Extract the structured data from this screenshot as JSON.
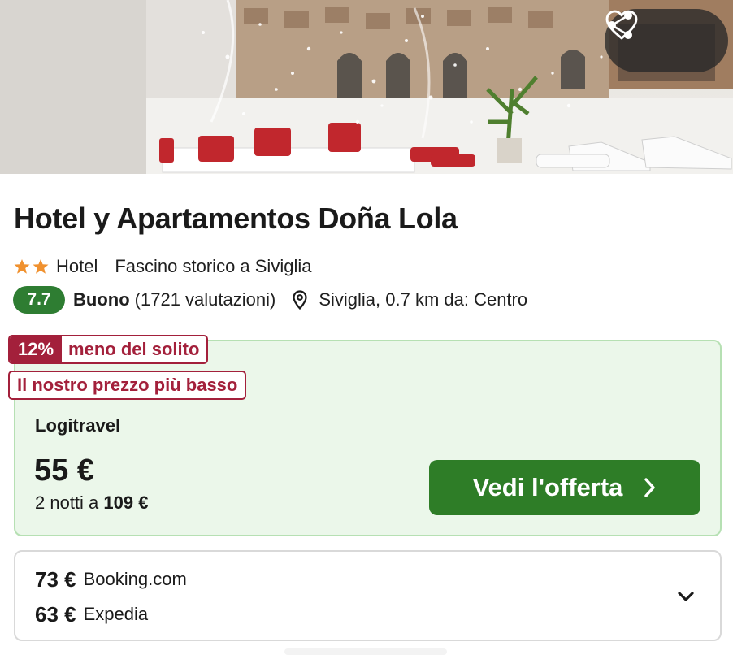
{
  "hero": {
    "image_alt": "",
    "share_icon": "share-icon",
    "favorite_icon": "heart-icon"
  },
  "hotel": {
    "name": "Hotel y Apartamentos Doña Lola",
    "stars": 2,
    "type": "Hotel",
    "tagline": "Fascino storico a Siviglia",
    "rating": "7.7",
    "rating_word": "Buono",
    "reviews": "(1721 valutazioni)",
    "location": "Siviglia, 0.7 km da: Centro"
  },
  "best_offer": {
    "discount_pct": "12%",
    "discount_text": "meno del solito",
    "lowest_label": "Il nostro prezzo più basso",
    "provider": "Logitravel",
    "price": "55 €",
    "nights_prefix": "2 notti a",
    "nights_total": "109 €",
    "cta_label": "Vedi l'offerta"
  },
  "other_offers": [
    {
      "price": "73 €",
      "provider": "Booking.com"
    },
    {
      "price": "63 €",
      "provider": "Expedia"
    }
  ],
  "colors": {
    "rating_badge": "#2e7d32",
    "cta": "#2e7d27",
    "deal_tag": "#a3203b",
    "offer_bg": "#ebf7ea",
    "star": "#f0912f"
  }
}
